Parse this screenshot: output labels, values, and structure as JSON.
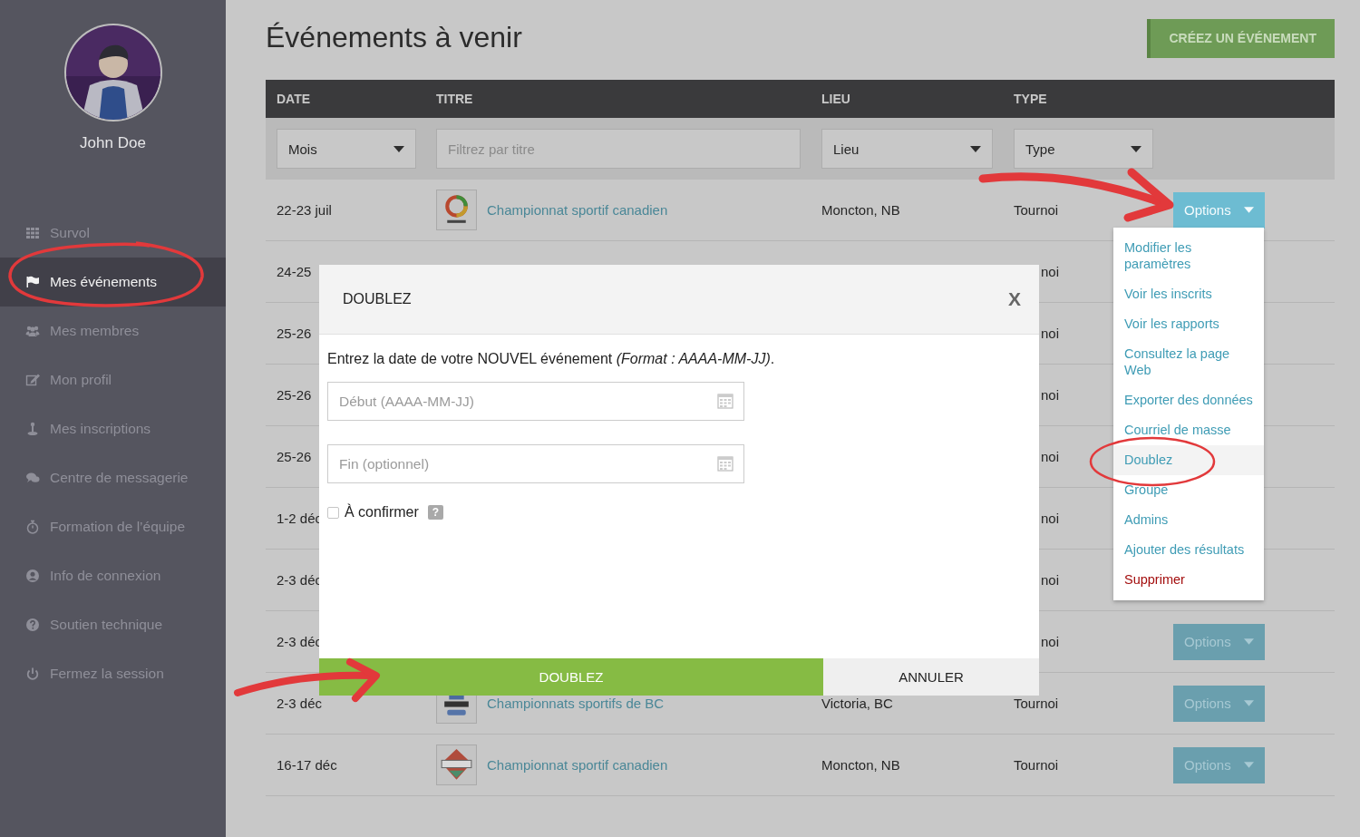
{
  "sidebar": {
    "user_name": "John Doe",
    "items": [
      {
        "label": "Survol",
        "selected": false
      },
      {
        "label": "Mes événements",
        "selected": true
      },
      {
        "label": "Mes membres",
        "selected": false
      },
      {
        "label": "Mon profil",
        "selected": false
      },
      {
        "label": "Mes inscriptions",
        "selected": false
      },
      {
        "label": "Centre de messagerie",
        "selected": false
      },
      {
        "label": "Formation de l’équipe",
        "selected": false
      },
      {
        "label": "Info de connexion",
        "selected": false
      },
      {
        "label": "Soutien technique",
        "selected": false
      },
      {
        "label": "Fermez la session",
        "selected": false
      }
    ]
  },
  "header": {
    "title": "Événements à venir",
    "create_button": "CRÉEZ UN ÉVÉNEMENT"
  },
  "table": {
    "columns": [
      "DATE",
      "TITRE",
      "LIEU",
      "TYPE"
    ],
    "filters": [
      {
        "kind": "select",
        "value": "Mois"
      },
      {
        "kind": "text",
        "placeholder": "Filtrez par titre"
      },
      {
        "kind": "select",
        "value": "Lieu"
      },
      {
        "kind": "select",
        "value": "Type"
      }
    ],
    "rows": [
      {
        "date": "22-23 juil",
        "logo": {
          "kind": "ring"
        },
        "title": "Championnat sportif canadien",
        "location": "Moncton, NB",
        "type": "Tournoi",
        "options": "Options",
        "menu_open": true
      },
      {
        "date": "24-25",
        "type": "noi",
        "partly_hidden": true
      },
      {
        "date": "25-26",
        "type": "noi",
        "partly_hidden": true
      },
      {
        "date": "25-26",
        "type": "noi",
        "partly_hidden": true
      },
      {
        "date": "25-26",
        "type": "noi",
        "partly_hidden": true
      },
      {
        "date": "1-2 déc",
        "type": "noi",
        "partly_hidden": true
      },
      {
        "date": "2-3 déc",
        "type": "noi",
        "partly_hidden": true
      },
      {
        "date": "2-3 déc",
        "type": "noi",
        "options": "Options",
        "menu_open": false,
        "partly_hidden": true
      },
      {
        "date": "2-3 déc",
        "logo": {
          "kind": "champs"
        },
        "title": "Championnats sportifs de BC",
        "location": "Victoria, BC",
        "type": "Tournoi",
        "options": "Options",
        "menu_open": false
      },
      {
        "date": "16-17 déc",
        "logo": {
          "kind": "emblem"
        },
        "title": "Championnat sportif canadien",
        "location": "Moncton, NB",
        "type": "Tournoi",
        "options": "Options",
        "menu_open": false
      }
    ]
  },
  "options_menu": {
    "items": [
      {
        "label": "Modifier les paramètres",
        "kind": "link",
        "selected": false
      },
      {
        "label": "Voir les inscrits",
        "kind": "link",
        "selected": false
      },
      {
        "label": "Voir les rapports",
        "kind": "link",
        "selected": false
      },
      {
        "label": "Consultez la page Web",
        "kind": "link",
        "selected": false
      },
      {
        "label": "Exporter des données",
        "kind": "link",
        "selected": false
      },
      {
        "label": "Courriel de masse",
        "kind": "link",
        "selected": false
      },
      {
        "label": "Doublez",
        "kind": "link",
        "selected": true
      },
      {
        "label": "Groupe",
        "kind": "link",
        "selected": false
      },
      {
        "label": "Admins",
        "kind": "link",
        "selected": false
      },
      {
        "label": "Ajouter des résultats",
        "kind": "link",
        "selected": false
      },
      {
        "label": "Supprimer",
        "kind": "danger",
        "selected": false
      }
    ]
  },
  "modal": {
    "title": "DOUBLEZ",
    "close": "X",
    "instruction": "Entrez la date de votre NOUVEL événement *(Format : AAAA-MM-JJ)*.",
    "fields": [
      {
        "placeholder": "Début (AAAA-MM-JJ)"
      },
      {
        "placeholder": "Fin (optionnel)"
      }
    ],
    "confirm": {
      "label": "À confirmer",
      "checked": false,
      "help": "?"
    },
    "buttons": [
      {
        "label": "DOUBLEZ",
        "kind": "primary"
      },
      {
        "label": "ANNULER",
        "kind": "secondary"
      }
    ]
  }
}
